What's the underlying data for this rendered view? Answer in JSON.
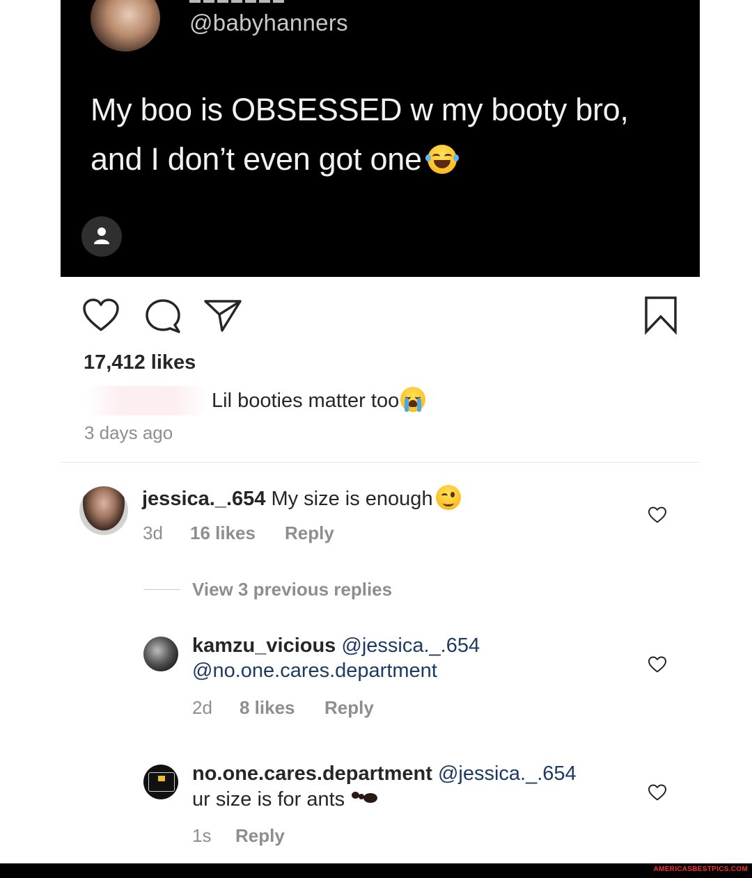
{
  "post": {
    "tweet": {
      "handle": "@babyhanners",
      "text_line1": "My boo is OBSESSED w my booty bro,",
      "text_line2": "and I don’t even got one"
    },
    "likes": "17,412 likes",
    "caption": "Lil booties matter too",
    "timestamp": "3 days ago"
  },
  "comments": [
    {
      "username": "jessica._.654",
      "text": "My size is enough",
      "time": "3d",
      "likes": "16 likes",
      "reply": "Reply"
    }
  ],
  "view_replies": "View 3 previous replies",
  "replies": [
    {
      "username": "kamzu_vicious",
      "mention1": "@jessica._.654",
      "mention2": "@no.one.cares.department",
      "time": "2d",
      "likes": "8 likes",
      "reply": "Reply"
    },
    {
      "username": "no.one.cares.department",
      "mention": "@jessica._.654",
      "text": "ur size is for ants",
      "time": "1s",
      "reply": "Reply"
    }
  ],
  "icons": {
    "like": "heart-icon",
    "comment": "comment-bubble-icon",
    "share": "paper-plane-icon",
    "save": "bookmark-icon",
    "tag": "person-icon"
  },
  "colors": {
    "text": "#262626",
    "secondary": "#8e8e8e",
    "mention": "#1d3a63",
    "tweet_bg": "#000000"
  },
  "watermark": "AMERICASBESTPICS.COM"
}
